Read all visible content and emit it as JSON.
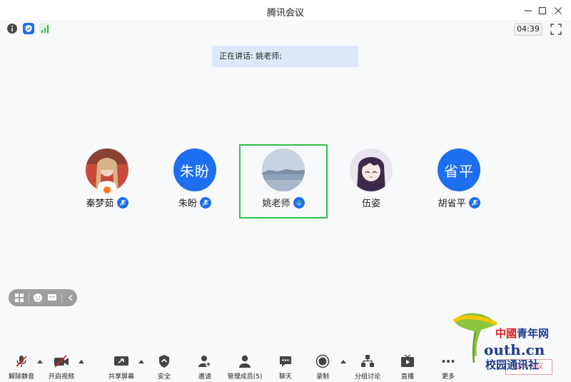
{
  "window": {
    "title": "腾讯会议"
  },
  "top_toolbar": {
    "timer": "04:39"
  },
  "speaking": {
    "text": "正在讲话: 姚老师;"
  },
  "participants": [
    {
      "name": "秦梦茹",
      "avatar_type": "photo",
      "mic": "muted-blue",
      "host": true
    },
    {
      "name": "朱盼",
      "avatar_type": "text",
      "avatar_text": "朱盼",
      "mic": "muted-blue"
    },
    {
      "name": "姚老师",
      "avatar_type": "photo",
      "mic": "speaking-green",
      "active": true
    },
    {
      "name": "伍姿",
      "avatar_type": "photo",
      "mic": "none"
    },
    {
      "name": "胡省平",
      "avatar_type": "text",
      "avatar_text": "省平",
      "mic": "muted-blue"
    }
  ],
  "bottom_toolbar": {
    "unmute": "解除静音",
    "start_video": "开启视频",
    "share_screen": "共享屏幕",
    "security": "安全",
    "invite": "邀请",
    "manage_members": "管理成员(5)",
    "chat": "聊天",
    "record": "录制",
    "breakout": "分组讨论",
    "live": "直播",
    "more": "更多"
  },
  "watermark": {
    "line1_red": "中國",
    "line1_blue": "青年网",
    "line2": "outh.cn",
    "line3": "校园通讯社",
    "end_button": "结束会议"
  },
  "colors": {
    "accent_blue": "#1d6ef0",
    "speaking_green": "#2ec24a",
    "banner_bg": "#dde9fb"
  }
}
